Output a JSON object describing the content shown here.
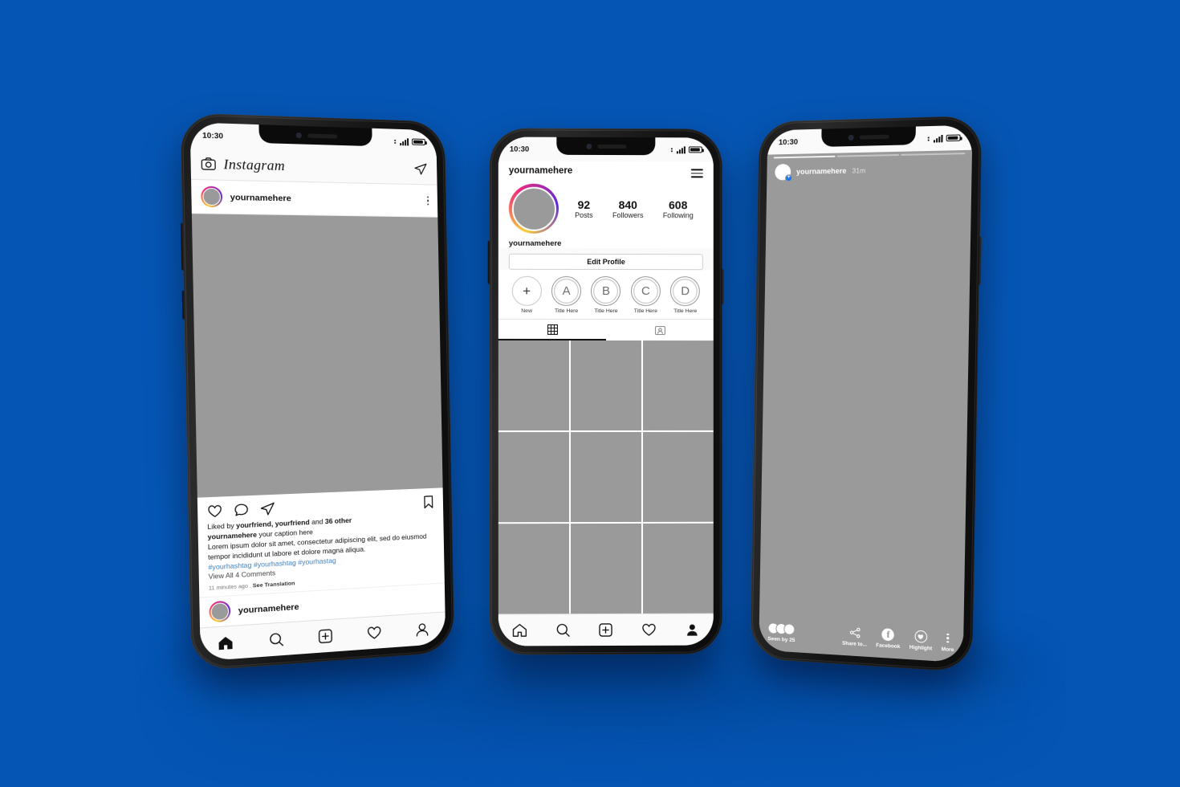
{
  "background_color": "#0455b4",
  "placeholder_gray": "#9a9a9a",
  "status_bar": {
    "time": "10:30"
  },
  "phone1_feed": {
    "app_name": "Instagram",
    "camera_icon": "camera-icon",
    "direct_icon": "paper-plane-icon",
    "post": {
      "username": "yournamehere",
      "menu_icon": "kebab-menu-icon",
      "like_icon": "heart-icon",
      "comment_icon": "speech-bubble-icon",
      "share_icon": "paper-plane-icon",
      "save_icon": "bookmark-icon",
      "liked_by_prefix": "Liked by ",
      "liked_by_names": "yourfriend, yourfriend",
      "liked_by_mid": " and ",
      "liked_by_others": "36 other",
      "caption_user": "yournamehere",
      "caption_text": " your caption here",
      "caption_body": "Lorem ipsum dolor sit amet, consectetur adipiscing elit, sed do eiusmod tempor incididunt ut labore et dolore magna aliqua.",
      "hashtags": "#yourhashtag #yourhashtag #yourhastag",
      "view_comments": "View All 4 Comments",
      "timestamp": "11 minutes ago . ",
      "see_translation": "See Translation",
      "footer_username": "yournamehere"
    },
    "tabbar": [
      {
        "name": "home-tab",
        "icon": "home-icon",
        "active": true
      },
      {
        "name": "search-tab",
        "icon": "search-icon",
        "active": false
      },
      {
        "name": "add-post-tab",
        "icon": "plus-square-icon",
        "active": false
      },
      {
        "name": "activity-tab",
        "icon": "heart-icon",
        "active": false
      },
      {
        "name": "profile-tab",
        "icon": "person-icon",
        "active": false
      }
    ]
  },
  "phone2_profile": {
    "username": "yournamehere",
    "menu_icon": "hamburger-menu-icon",
    "stats": [
      {
        "num": "92",
        "label": "Posts"
      },
      {
        "num": "840",
        "label": "Followers"
      },
      {
        "num": "608",
        "label": "Following"
      }
    ],
    "display_name": "yournamehere",
    "edit_profile_label": "Edit Profile",
    "highlights": [
      {
        "glyph": "+",
        "label": "New",
        "is_new": true
      },
      {
        "glyph": "A",
        "label": "Title Here",
        "is_new": false
      },
      {
        "glyph": "B",
        "label": "Title Here",
        "is_new": false
      },
      {
        "glyph": "C",
        "label": "Title Here",
        "is_new": false
      },
      {
        "glyph": "D",
        "label": "Title Here",
        "is_new": false
      }
    ],
    "tabs": [
      {
        "name": "grid-tab",
        "icon": "grid-icon",
        "active": true
      },
      {
        "name": "tagged-tab",
        "icon": "tagged-person-icon",
        "active": false
      }
    ],
    "grid_cells": 9,
    "tabbar": [
      {
        "name": "home-tab",
        "icon": "home-icon",
        "active": false
      },
      {
        "name": "search-tab",
        "icon": "search-icon",
        "active": false
      },
      {
        "name": "add-post-tab",
        "icon": "plus-square-icon",
        "active": false
      },
      {
        "name": "activity-tab",
        "icon": "heart-icon",
        "active": false
      },
      {
        "name": "profile-tab",
        "icon": "person-icon",
        "active": true
      }
    ]
  },
  "phone3_story": {
    "username": "yournamehere",
    "time_ago": "31m",
    "add_badge": "+",
    "seen_by": "Seen by 25",
    "actions": [
      {
        "name": "share-to-action",
        "label": "Share to...",
        "icon": "share-nodes-icon"
      },
      {
        "name": "facebook-action",
        "label": "Facebook",
        "icon": "facebook-icon"
      },
      {
        "name": "highlight-action",
        "label": "Highlight",
        "icon": "highlight-heart-icon"
      },
      {
        "name": "more-action",
        "label": "More",
        "icon": "kebab-menu-icon"
      }
    ],
    "progress_segments": 3
  }
}
